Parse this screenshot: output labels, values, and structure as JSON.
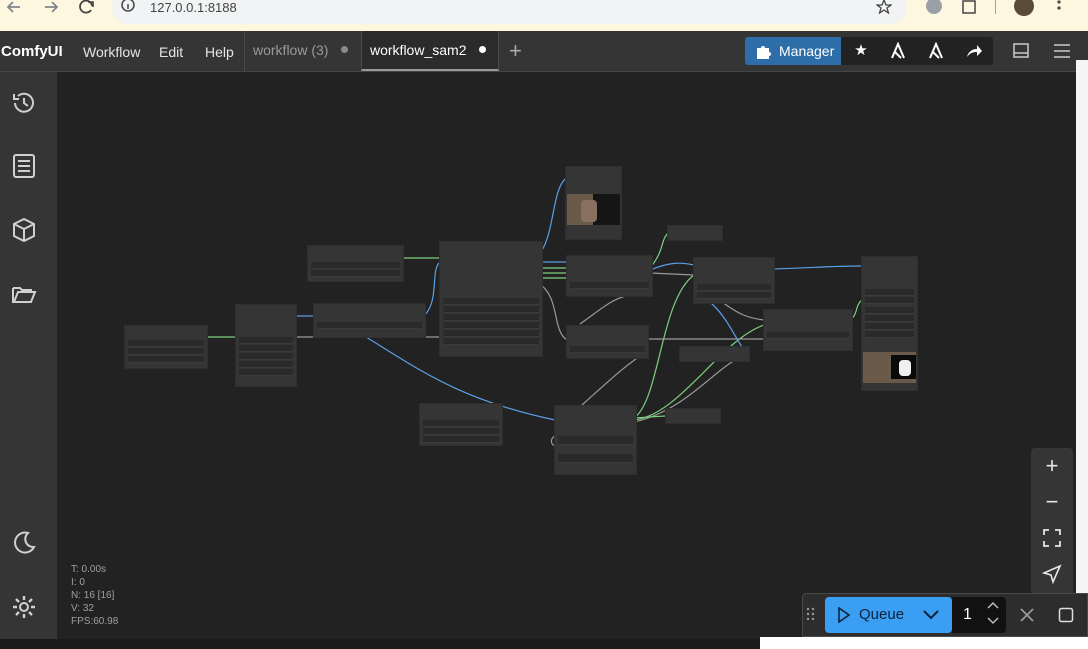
{
  "browser": {
    "url": "127.0.0.1:8188",
    "back_icon": "arrow-left-icon",
    "forward_icon": "arrow-right-icon",
    "reload_icon": "reload-icon"
  },
  "app": {
    "brand": "ComfyUI",
    "menu": [
      "Workflow",
      "Edit",
      "Help"
    ],
    "tabs": [
      {
        "label": "workflow (3)",
        "active": false
      },
      {
        "label": "workflow_sam2",
        "active": true
      }
    ],
    "manager_label": "Manager"
  },
  "stats": {
    "t": "T: 0.00s",
    "i": "I: 0",
    "n": "N: 16 [16]",
    "v": "V: 32",
    "fps": "FPS:60.98"
  },
  "queue": {
    "label": "Queue",
    "count": "1"
  },
  "colors": {
    "accent": "#2d6da8",
    "queue": "#3a9ef2",
    "link_blue": "#5aa0e6",
    "link_green": "#7ed07e",
    "link_gray": "#9a9a9a"
  }
}
